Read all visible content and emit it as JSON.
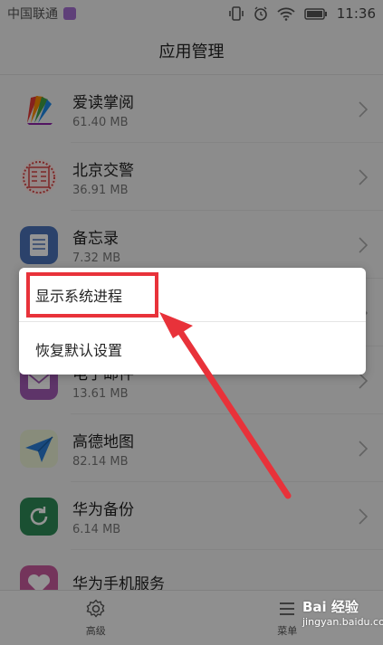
{
  "status_bar": {
    "carrier": "中国联通",
    "time": "11:36"
  },
  "title": "应用管理",
  "apps": [
    {
      "name": "爱读掌阅",
      "size": "61.40 MB",
      "icon": "book-fan-icon"
    },
    {
      "name": "北京交警",
      "size": "36.91 MB",
      "icon": "seal-icon"
    },
    {
      "name": "备忘录",
      "size": "7.32 MB",
      "icon": "memo-icon"
    },
    {
      "name": "",
      "size": "",
      "icon": "hidden-app-icon"
    },
    {
      "name": "电子邮件",
      "size": "13.61 MB",
      "icon": "envelope-icon"
    },
    {
      "name": "高德地图",
      "size": "82.14 MB",
      "icon": "paper-plane-icon"
    },
    {
      "name": "华为备份",
      "size": "6.14 MB",
      "icon": "backup-icon"
    },
    {
      "name": "华为手机服务",
      "size": "",
      "icon": "heart-icon"
    }
  ],
  "popup": {
    "item1": "显示系统进程",
    "item2": "恢复默认设置"
  },
  "bottom_bar": {
    "advanced": "高级",
    "menu": "菜单"
  },
  "watermark": {
    "brand": "Bai 经验",
    "url": "jingyan.baidu.com"
  },
  "colors": {
    "highlight": "#e8323a",
    "overlay": "rgba(0,0,0,0.42)"
  }
}
